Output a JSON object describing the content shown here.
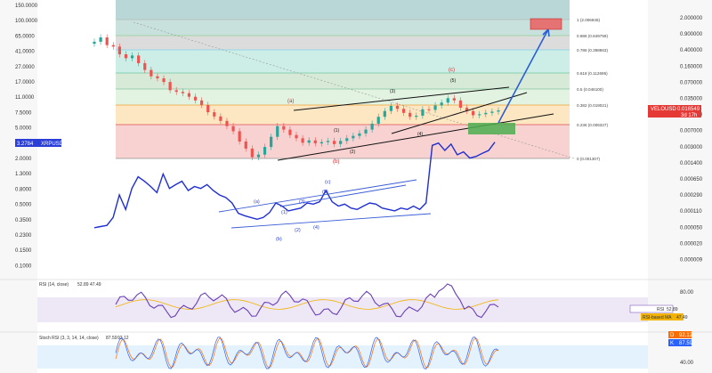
{
  "chart_data": {
    "type": "candlestick",
    "series": [
      {
        "name": "VELOUSD",
        "value": "0.016549",
        "sub": "3d 17h"
      },
      {
        "name": "XRPUSD",
        "value": "3.2784"
      }
    ],
    "velo_axis": [
      "2.000000",
      "0.900000",
      "0.400000",
      "0.160000",
      "0.070000",
      "0.035000",
      "0.015000",
      "0.007000",
      "0.003000",
      "0.001400",
      "0.000650",
      "0.000290",
      "0.000110",
      "0.000050",
      "0.000020",
      "0.000009"
    ],
    "xrp_axis": [
      "150.0000",
      "100.0000",
      "65.0000",
      "41.0000",
      "27.0000",
      "17.0000",
      "11.0000",
      "7.5000",
      "5.0000",
      "3.2784",
      "2.0000",
      "1.3000",
      "0.8000",
      "0.5000",
      "0.3500",
      "0.2300",
      "0.1500",
      "0.1000"
    ],
    "fib_levels": [
      {
        "label": "1 (2.006846)",
        "color": "#b7b7b7"
      },
      {
        "label": "0.886 (0.849759)",
        "color": "#8fd18f"
      },
      {
        "label": "0.786 (0.398863)",
        "color": "#7fd0ec"
      },
      {
        "label": "0.618 (0.112695)",
        "color": "#6cc7a3"
      },
      {
        "label": "0.5 (0.046100)",
        "color": "#7fc7a0"
      },
      {
        "label": "0.382 (0.019021)",
        "color": "#f0a030"
      },
      {
        "label": "0.236 (0.006327)",
        "color": "#e05050"
      },
      {
        "label": "0 (0.001307)",
        "color": "#909090"
      }
    ],
    "wave_labels_black": [
      "(1)",
      "(2)",
      "(3)",
      "(4)",
      "(5)",
      "(1)",
      "(2)",
      "(3)",
      "(4)",
      "(5)"
    ],
    "wave_labels_red": [
      "(a)",
      "(b)",
      "(c)"
    ],
    "wave_labels_blue": [
      "(a)",
      "(b)",
      "(c)",
      "(1)",
      "(2)",
      "(3)",
      "(4)",
      "(5)"
    ],
    "velo_close": [
      0.62,
      0.78,
      0.52,
      0.48,
      0.32,
      0.26,
      0.3,
      0.2,
      0.14,
      0.1,
      0.09,
      0.074,
      0.048,
      0.044,
      0.041,
      0.034,
      0.028,
      0.022,
      0.015,
      0.012,
      0.0095,
      0.0072,
      0.0055,
      0.0032,
      0.0022,
      0.0014,
      0.0016,
      0.0024,
      0.0041,
      0.0072,
      0.006,
      0.0045,
      0.0038,
      0.003,
      0.0034,
      0.0029,
      0.0031,
      0.0033,
      0.0028,
      0.0033,
      0.0038,
      0.0043,
      0.0049,
      0.006,
      0.0082,
      0.0118,
      0.016,
      0.021,
      0.018,
      0.0145,
      0.0118,
      0.0125,
      0.0175,
      0.017,
      0.0215,
      0.025,
      0.0315,
      0.028,
      0.019,
      0.016,
      0.0128,
      0.0135,
      0.0145,
      0.0155,
      0.0165
    ],
    "xrp_line": [
      0.3,
      0.31,
      0.32,
      0.4,
      0.75,
      0.5,
      0.9,
      1.25,
      1.1,
      0.95,
      0.8,
      1.35,
      0.9,
      1.0,
      1.1,
      0.85,
      0.95,
      0.9,
      1.0,
      0.85,
      0.75,
      0.7,
      0.6,
      0.45,
      0.42,
      0.4,
      0.38,
      0.4,
      0.46,
      0.6,
      0.55,
      0.48,
      0.5,
      0.52,
      0.6,
      0.58,
      0.62,
      0.85,
      0.62,
      0.55,
      0.58,
      0.52,
      0.5,
      0.55,
      0.6,
      0.58,
      0.52,
      0.5,
      0.48,
      0.52,
      0.5,
      0.55,
      0.5,
      0.6,
      3.0,
      3.2,
      2.6,
      3.1,
      2.3,
      2.5,
      2.1,
      2.2,
      2.4,
      2.6,
      3.2784
    ],
    "rsi": {
      "title": "RSI (14, close)",
      "title_values": [
        "52.89",
        "47.49"
      ],
      "rsi_label": "RSI",
      "rsi_value": "52.89",
      "ma_label": "RSI-based MA",
      "ma_value": "47.49",
      "axis": [
        "80.00",
        "40.00"
      ]
    },
    "stoch": {
      "title": "Stoch RSI (3, 3, 14, 14, close)",
      "title_values": [
        "87.59",
        "92.12"
      ],
      "d_label": "D",
      "d_value": "92.12",
      "k_label": "K",
      "k_value": "87.59",
      "axis": [
        "80.00",
        "40.00"
      ]
    },
    "colors": {
      "up": "#26a69a",
      "down": "#ef5350",
      "velo_label_bg": "#e53935",
      "xrp_label_bg": "#2b3fd6",
      "xrp_line": "#1f2fd1",
      "projection": "#2b5fd6",
      "rsi_line": "#6a3fb8",
      "rsi_ma": "#f2b300",
      "stoch_k": "#2962ff",
      "stoch_d": "#ff6d00"
    }
  }
}
